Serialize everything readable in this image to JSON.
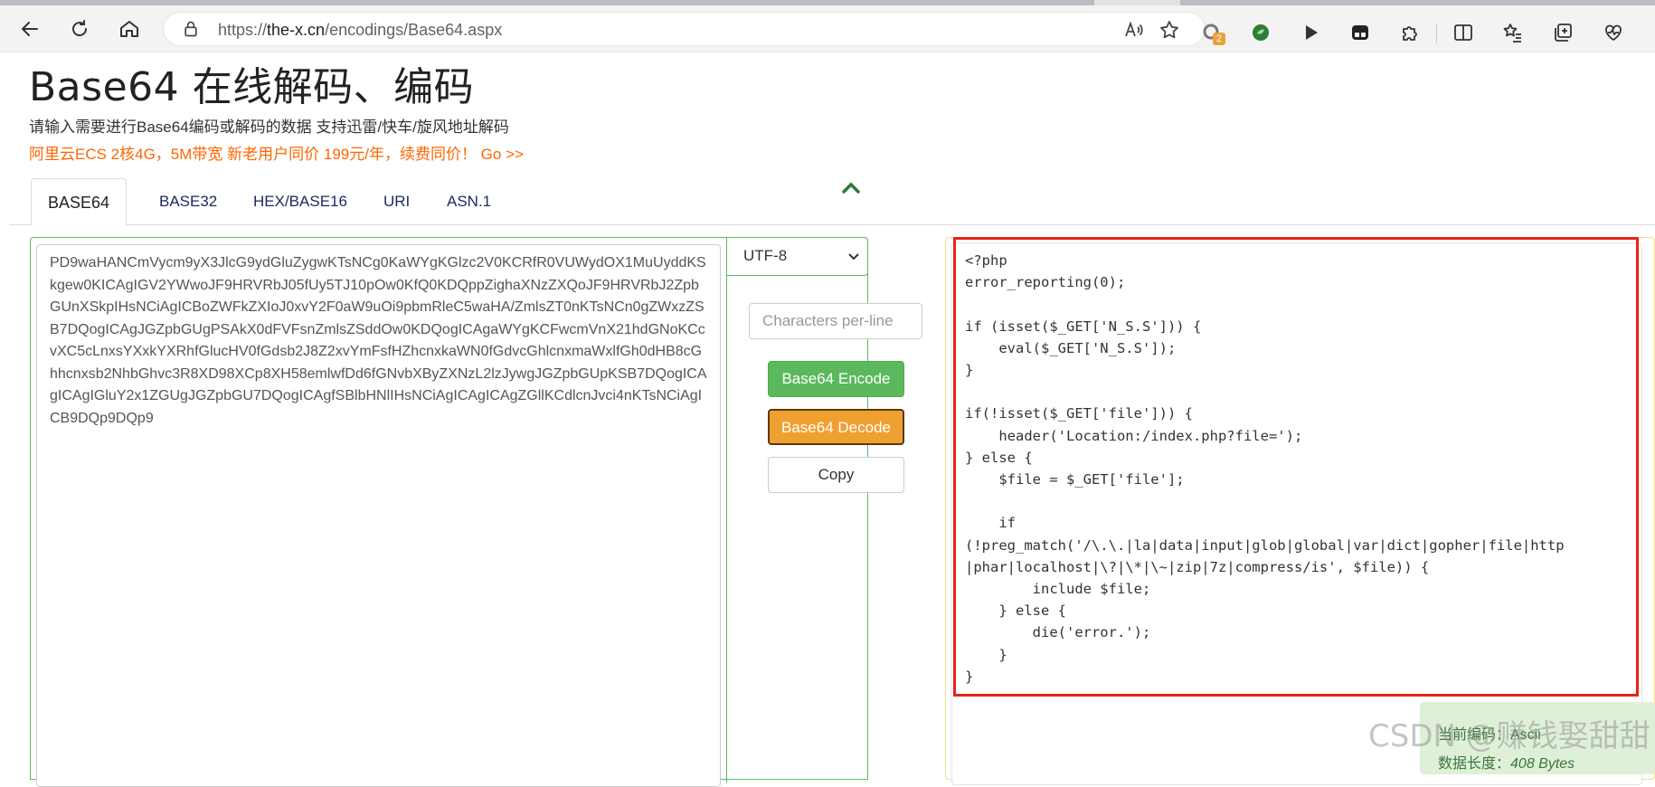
{
  "browser": {
    "url_prefix": "https://",
    "url_host": "the-x.cn",
    "url_path": "/encodings/Base64.aspx",
    "extension_badge": "2"
  },
  "page": {
    "title": "Base64 在线解码、编码",
    "description": "请输入需要进行Base64编码或解码的数据 支持迅雷/快车/旋风地址解码",
    "promo": "阿里云ECS 2核4G，5M带宽 新老用户同价 199元/年，续费同价！ Go >>"
  },
  "tabs": [
    {
      "label": "BASE64",
      "active": true
    },
    {
      "label": "BASE32",
      "active": false
    },
    {
      "label": "HEX/BASE16",
      "active": false
    },
    {
      "label": "URI",
      "active": false
    },
    {
      "label": "ASN.1",
      "active": false
    }
  ],
  "input": {
    "value": "PD9waHANCmVycm9yX3JlcG9ydGluZygwKTsNCg0KaWYgKGlzc2V0KCRfR0VUWydOX1MuUyddKSkgew0KICAgIGV2YWwoJF9HRVRbJ05fUy5TJ10pOw0KfQ0KDQppZighaXNzZXQoJF9HRVRbJ2ZpbGUnXSkpIHsNCiAgICBoZWFkZXIoJ0xvY2F0aW9uOi9pbmRleC5waHA/ZmlsZT0nKTsNCn0gZWxzZSB7DQogICAgJGZpbGUgPSAkX0dFVFsnZmlsZSddOw0KDQogICAgaWYgKCFwcmVnX21hdGNoKCcvXC5cLnxsYXxkYXRhfGlucHV0fGdsb2J8Z2xvYmFsfHZhcnxkaWN0fGdvcGhlcnxmaWxlfGh0dHB8cGhhcnxsb2NhbGhvc3R8XD98XCp8XH58emlwfDd6fGNvbXByZXNzL2lzJywgJGZpbGUpKSB7DQogICAgICAgIGluY2x1ZGUgJGZpbGU7DQogICAgfSBlbHNlIHsNCiAgICAgICAgZGllKCdlcnJvci4nKTsNCiAgICB9DQp9DQp9"
  },
  "controls": {
    "charset": "UTF-8",
    "chars_per_line_placeholder": "Characters per-line",
    "encode_label": "Base64 Encode",
    "decode_label": "Base64 Decode",
    "copy_label": "Copy"
  },
  "output": {
    "code": "<?php\nerror_reporting(0);\n\nif (isset($_GET['N_S.S'])) {\n    eval($_GET['N_S.S']);\n}\n\nif(!isset($_GET['file'])) {\n    header('Location:/index.php?file=');\n} else {\n    $file = $_GET['file'];\n\n    if\n(!preg_match('/\\.\\.|la|data|input|glob|global|var|dict|gopher|file|http\n|phar|localhost|\\?|\\*|\\~|zip|7z|compress/is', $file)) {\n        include $file;\n    } else {\n        die('error.');\n    }\n}"
  },
  "info": {
    "encoding_line": "当前编码：Ascii",
    "length_label": "数据长度：",
    "length_value": "408 Bytes"
  },
  "watermark": "CSDN @赚钱娶甜甜",
  "colors": {
    "green": "#5cb85c",
    "orange": "#f0a030",
    "promo": "#ff6600",
    "highlight_red": "#e8231b"
  }
}
